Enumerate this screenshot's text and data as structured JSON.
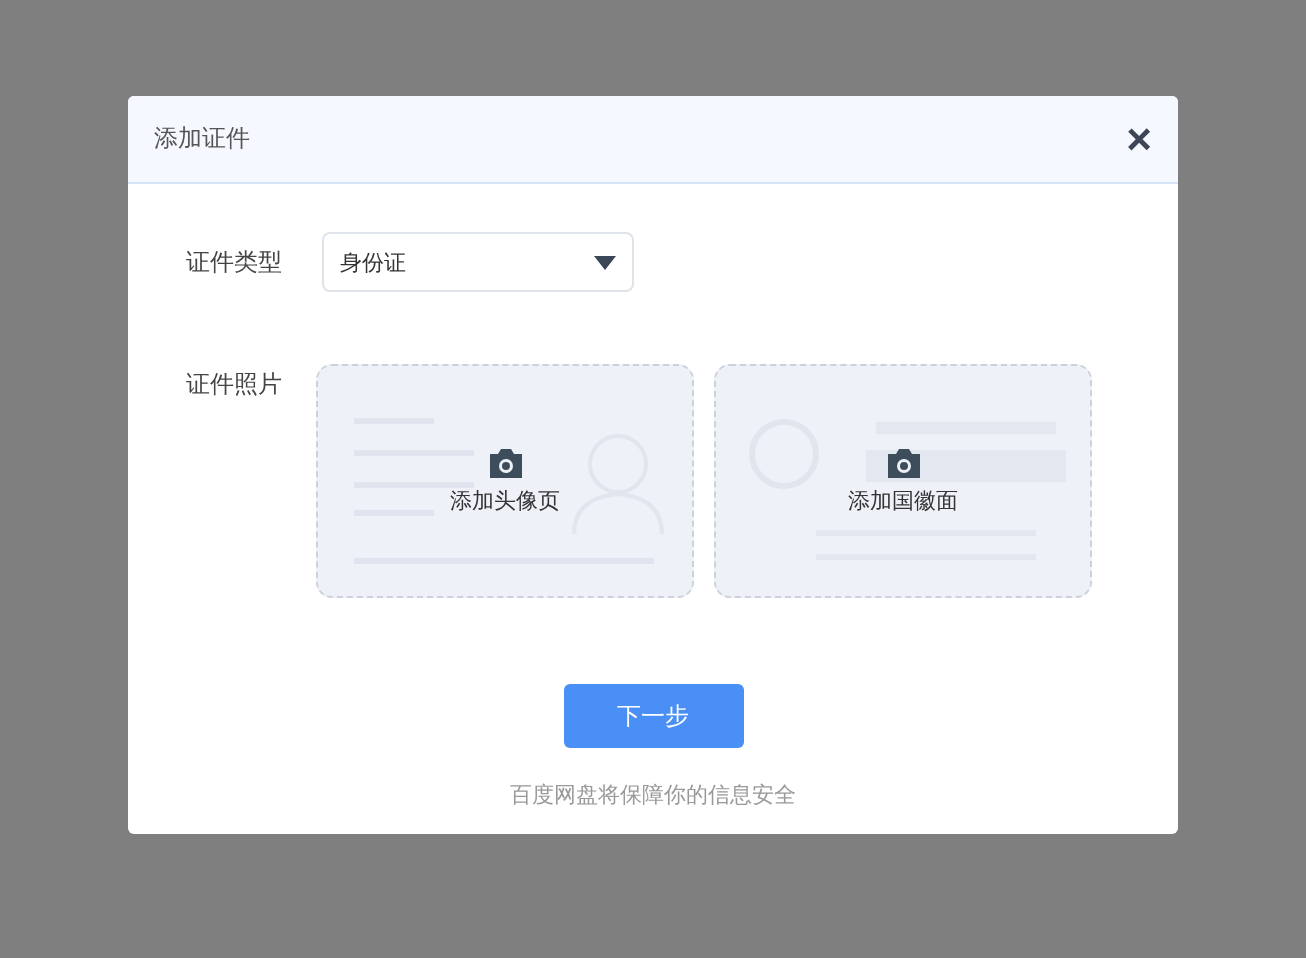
{
  "dialog": {
    "title": "添加证件",
    "close": "×"
  },
  "id_type": {
    "label": "证件类型",
    "value": "身份证"
  },
  "id_photo": {
    "label": "证件照片",
    "slots": [
      {
        "kind": "front",
        "caption": "添加头像页"
      },
      {
        "kind": "back",
        "caption": "添加国徽面"
      }
    ]
  },
  "next_button": "下一步",
  "footer_note": "百度网盘将保障你的信息安全"
}
